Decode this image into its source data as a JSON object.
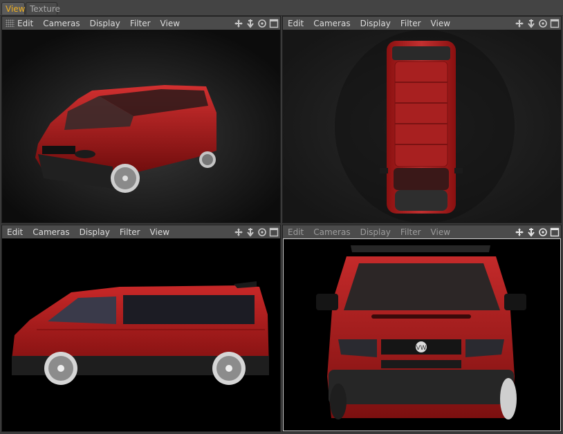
{
  "tabs": [
    {
      "label": "View",
      "active": true
    },
    {
      "label": "Texture",
      "active": false
    }
  ],
  "viewports": {
    "perspective": {
      "menu": [
        "Edit",
        "Cameras",
        "Display",
        "Filter",
        "View"
      ]
    },
    "top": {
      "menu": [
        "Edit",
        "Cameras",
        "Display",
        "Filter",
        "View"
      ]
    },
    "left": {
      "menu": [
        "Edit",
        "Cameras",
        "Display",
        "Filter",
        "View"
      ]
    },
    "front": {
      "menu": [
        "Edit",
        "Cameras",
        "Display",
        "Filter",
        "View"
      ],
      "active": true
    }
  },
  "nav_icons": [
    "move-icon",
    "zoom-arrow-icon",
    "rotate-icon",
    "maximize-icon"
  ],
  "colors": {
    "accent": "#f0b020",
    "van_red": "#b01818",
    "viewport_bg": "#000000",
    "panel_bg": "#3a3a3a"
  }
}
